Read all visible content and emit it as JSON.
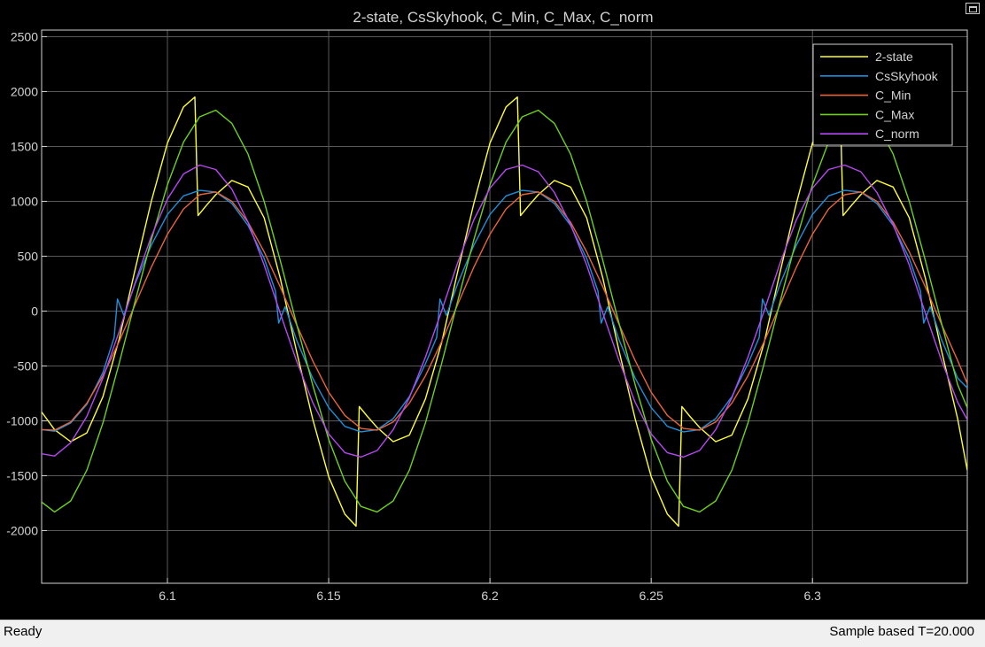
{
  "statusbar": {
    "status": "Ready",
    "sample_info": "Sample based  T=20.000"
  },
  "colors": {
    "background": "#000000",
    "grid": "#5a5a5a",
    "axis_text": "#d2d2d2",
    "legend_bg": "#000000",
    "legend_border": "#d2d2d2"
  },
  "chart_data": {
    "type": "line",
    "title": "2-state, CsSkyhook, C_Min, C_Max, C_norm",
    "xlabel": "",
    "ylabel": "",
    "xlim": [
      6.061,
      6.348
    ],
    "ylim": [
      -2480,
      2560
    ],
    "xticks": [
      6.1,
      6.15,
      6.2,
      6.25,
      6.3
    ],
    "xtick_labels": [
      "6.1",
      "6.15",
      "6.2",
      "6.25",
      "6.3"
    ],
    "yticks": [
      -2000,
      -1500,
      -1000,
      -500,
      0,
      500,
      1000,
      1500,
      2000,
      2500
    ],
    "ytick_labels": [
      "-2000",
      "-1500",
      "-1000",
      "-500",
      "0",
      "500",
      "1000",
      "1500",
      "2000",
      "2500"
    ],
    "grid": true,
    "legend_position": "top-right",
    "series": [
      {
        "name": "2-state",
        "color": "#ffff33",
        "x": [
          6.061,
          6.065,
          6.07,
          6.075,
          6.08,
          6.085,
          6.09,
          6.095,
          6.1,
          6.105,
          6.1085,
          6.1095,
          6.112,
          6.115,
          6.12,
          6.125,
          6.13,
          6.135,
          6.14,
          6.145,
          6.15,
          6.155,
          6.1585,
          6.1595,
          6.162,
          6.165,
          6.17,
          6.175,
          6.18,
          6.185,
          6.19,
          6.195,
          6.2,
          6.205,
          6.2085,
          6.2095,
          6.212,
          6.215,
          6.22,
          6.225,
          6.23,
          6.235,
          6.24,
          6.245,
          6.25,
          6.255,
          6.2585,
          6.2595,
          6.262,
          6.265,
          6.27,
          6.275,
          6.28,
          6.285,
          6.29,
          6.295,
          6.3,
          6.305,
          6.3085,
          6.3095,
          6.312,
          6.315,
          6.32,
          6.325,
          6.33,
          6.335,
          6.34,
          6.345,
          6.348
        ],
        "y": [
          -920,
          -1080,
          -1190,
          -1110,
          -780,
          -260,
          380,
          1000,
          1530,
          1860,
          1950,
          870,
          960,
          1060,
          1190,
          1130,
          850,
          300,
          -360,
          -980,
          -1510,
          -1850,
          -1960,
          -870,
          -960,
          -1060,
          -1190,
          -1130,
          -800,
          -290,
          360,
          980,
          1530,
          1860,
          1950,
          870,
          960,
          1060,
          1190,
          1130,
          850,
          300,
          -360,
          -980,
          -1510,
          -1850,
          -1960,
          -870,
          -960,
          -1060,
          -1190,
          -1130,
          -800,
          -290,
          360,
          980,
          1530,
          1860,
          1950,
          870,
          960,
          1060,
          1190,
          1130,
          850,
          300,
          -360,
          -980,
          -1450
        ]
      },
      {
        "name": "CsSkyhook",
        "color": "#1e8fdb",
        "x": [
          6.061,
          6.065,
          6.07,
          6.075,
          6.08,
          6.0835,
          6.0845,
          6.0865,
          6.09,
          6.095,
          6.1,
          6.105,
          6.11,
          6.115,
          6.12,
          6.125,
          6.13,
          6.1335,
          6.1345,
          6.1365,
          6.14,
          6.145,
          6.15,
          6.155,
          6.16,
          6.165,
          6.17,
          6.175,
          6.18,
          6.1835,
          6.1845,
          6.1865,
          6.19,
          6.195,
          6.2,
          6.205,
          6.21,
          6.215,
          6.22,
          6.225,
          6.23,
          6.2335,
          6.2345,
          6.2365,
          6.24,
          6.245,
          6.25,
          6.255,
          6.26,
          6.265,
          6.27,
          6.275,
          6.28,
          6.2835,
          6.2845,
          6.2865,
          6.29,
          6.295,
          6.3,
          6.305,
          6.31,
          6.315,
          6.32,
          6.325,
          6.33,
          6.3335,
          6.3345,
          6.3365,
          6.34,
          6.345,
          6.348
        ],
        "y": [
          -1080,
          -1095,
          -1020,
          -850,
          -560,
          -240,
          110,
          -40,
          250,
          600,
          880,
          1050,
          1100,
          1085,
          980,
          780,
          480,
          180,
          -110,
          40,
          -260,
          -610,
          -880,
          -1050,
          -1100,
          -1080,
          -980,
          -780,
          -480,
          -240,
          110,
          -40,
          250,
          600,
          880,
          1050,
          1100,
          1085,
          980,
          780,
          480,
          180,
          -110,
          40,
          -260,
          -610,
          -880,
          -1050,
          -1100,
          -1080,
          -980,
          -780,
          -480,
          -240,
          110,
          -40,
          250,
          600,
          880,
          1050,
          1100,
          1085,
          980,
          780,
          480,
          180,
          -110,
          40,
          -260,
          -610,
          -700
        ]
      },
      {
        "name": "C_Min",
        "color": "#e8643a",
        "x": [
          6.061,
          6.065,
          6.07,
          6.075,
          6.08,
          6.085,
          6.09,
          6.095,
          6.1,
          6.105,
          6.11,
          6.115,
          6.12,
          6.125,
          6.13,
          6.135,
          6.14,
          6.145,
          6.15,
          6.155,
          6.16,
          6.165,
          6.17,
          6.175,
          6.18,
          6.185,
          6.19,
          6.195,
          6.2,
          6.205,
          6.21,
          6.215,
          6.22,
          6.225,
          6.23,
          6.235,
          6.24,
          6.245,
          6.25,
          6.255,
          6.26,
          6.265,
          6.27,
          6.275,
          6.28,
          6.285,
          6.29,
          6.295,
          6.3,
          6.305,
          6.31,
          6.315,
          6.32,
          6.325,
          6.33,
          6.335,
          6.34,
          6.345,
          6.348
        ],
        "y": [
          -1080,
          -1085,
          -1010,
          -840,
          -590,
          -280,
          60,
          400,
          700,
          930,
          1060,
          1085,
          1000,
          810,
          540,
          220,
          -120,
          -450,
          -740,
          -950,
          -1070,
          -1085,
          -1010,
          -840,
          -590,
          -280,
          60,
          400,
          700,
          930,
          1060,
          1085,
          1000,
          810,
          540,
          220,
          -120,
          -450,
          -740,
          -950,
          -1070,
          -1085,
          -1010,
          -840,
          -590,
          -280,
          60,
          400,
          700,
          930,
          1060,
          1085,
          1000,
          810,
          540,
          220,
          -120,
          -450,
          -660
        ]
      },
      {
        "name": "C_Max",
        "color": "#6fd119",
        "x": [
          6.061,
          6.065,
          6.07,
          6.075,
          6.08,
          6.085,
          6.09,
          6.095,
          6.1,
          6.105,
          6.11,
          6.115,
          6.12,
          6.125,
          6.13,
          6.135,
          6.14,
          6.145,
          6.15,
          6.155,
          6.16,
          6.165,
          6.17,
          6.175,
          6.18,
          6.185,
          6.19,
          6.195,
          6.2,
          6.205,
          6.21,
          6.215,
          6.22,
          6.225,
          6.23,
          6.235,
          6.24,
          6.245,
          6.25,
          6.255,
          6.26,
          6.265,
          6.27,
          6.275,
          6.28,
          6.285,
          6.29,
          6.295,
          6.3,
          6.305,
          6.31,
          6.315,
          6.32,
          6.325,
          6.33,
          6.335,
          6.34,
          6.345,
          6.348
        ],
        "y": [
          -1740,
          -1830,
          -1730,
          -1450,
          -1020,
          -480,
          90,
          650,
          1150,
          1540,
          1770,
          1830,
          1710,
          1430,
          1000,
          460,
          -110,
          -670,
          -1170,
          -1550,
          -1780,
          -1830,
          -1730,
          -1450,
          -1020,
          -480,
          90,
          650,
          1150,
          1540,
          1770,
          1830,
          1710,
          1430,
          1000,
          460,
          -110,
          -670,
          -1170,
          -1550,
          -1780,
          -1830,
          -1730,
          -1450,
          -1020,
          -480,
          90,
          650,
          1150,
          1540,
          1770,
          1830,
          1710,
          1430,
          1000,
          460,
          -110,
          -670,
          -880
        ]
      },
      {
        "name": "C_norm",
        "color": "#b648f2",
        "x": [
          6.061,
          6.065,
          6.07,
          6.075,
          6.08,
          6.085,
          6.09,
          6.095,
          6.1,
          6.105,
          6.11,
          6.115,
          6.12,
          6.125,
          6.13,
          6.135,
          6.14,
          6.145,
          6.15,
          6.155,
          6.16,
          6.165,
          6.17,
          6.175,
          6.18,
          6.185,
          6.19,
          6.195,
          6.2,
          6.205,
          6.21,
          6.215,
          6.22,
          6.225,
          6.23,
          6.235,
          6.24,
          6.245,
          6.25,
          6.255,
          6.26,
          6.265,
          6.27,
          6.275,
          6.28,
          6.285,
          6.29,
          6.295,
          6.3,
          6.305,
          6.31,
          6.315,
          6.32,
          6.325,
          6.33,
          6.335,
          6.34,
          6.345,
          6.348
        ],
        "y": [
          -1300,
          -1320,
          -1200,
          -960,
          -610,
          -190,
          260,
          680,
          1020,
          1250,
          1330,
          1290,
          1110,
          810,
          420,
          -20,
          -450,
          -830,
          -1120,
          -1290,
          -1330,
          -1270,
          -1080,
          -790,
          -420,
          0,
          440,
          830,
          1120,
          1290,
          1330,
          1270,
          1080,
          790,
          420,
          -20,
          -450,
          -830,
          -1120,
          -1290,
          -1330,
          -1270,
          -1080,
          -790,
          -420,
          0,
          440,
          830,
          1120,
          1290,
          1330,
          1270,
          1080,
          790,
          420,
          -20,
          -450,
          -830,
          -990
        ]
      }
    ]
  }
}
